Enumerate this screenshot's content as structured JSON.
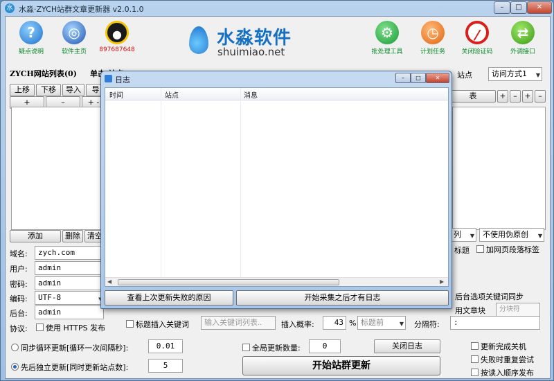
{
  "window": {
    "title": "水淼·ZYCH站群文章更新器 v2.0.1.0",
    "minimize": "–",
    "maximize": "□",
    "close": "✕"
  },
  "toolbar": {
    "help_label": "疑点说明",
    "homepage_label": "软件主页",
    "qq_label": "897687648",
    "batch_label": "批处理工具",
    "schedule_label": "计划任务",
    "captcha_label": "关闭验证码",
    "api_label": "外调接口",
    "brand_name": "水淼软件",
    "brand_url": "shuimiao.net"
  },
  "site_list": {
    "title": "ZYCH网站列表(0)",
    "hint": "单击:站点",
    "move_up": "上移",
    "move_down": "下移",
    "import": "导入",
    "export": "导",
    "plus": "+",
    "minus": "–",
    "plus2": "+ -",
    "add": "添加",
    "delete": "删除",
    "clear": "清空"
  },
  "right": {
    "site_label": "站点",
    "access_mode": "访问方式1",
    "small_buttons": [
      "+",
      "–",
      "+",
      "–"
    ],
    "table_fragment": "表",
    "combo_fragment": "列",
    "pseudo_original": "不使用伪原创",
    "title_fragment": "标题",
    "add_tags": "加网页段落标签",
    "keyword_sync": "后台选项关键词同步",
    "article_block": "用文章块",
    "separator_placeholder": "分块符"
  },
  "form": {
    "domain_label": "域名:",
    "domain_value": "zych.com",
    "user_label": "用户:",
    "user_value": "admin",
    "password_label": "密码:",
    "password_value": "admin",
    "encoding_label": "编码:",
    "encoding_value": "UTF-8",
    "backend_label": "后台:",
    "backend_value": "admin",
    "protocol_label": "协议:",
    "https_label": "使用 HTTPS 发布"
  },
  "options": {
    "title_keyword_label": "标题插入关键词",
    "keyword_placeholder": "输入关键词列表..",
    "insert_rate_label": "插入概率:",
    "insert_rate_value": "43",
    "percent": "%",
    "position_value": "标题前",
    "separator_label": "分隔符:",
    "separator_value": ":"
  },
  "bottom": {
    "sync_loop_label": "同步循环更新[循环一次间隔秒]:",
    "sync_loop_value": "0.01",
    "sequential_label": "先后独立更新[同时更新站点数]:",
    "sequential_value": "5",
    "global_count_label": "全局更新数量:",
    "global_count_value": "0",
    "close_log": "关闭日志",
    "start_update": "开始站群更新",
    "shutdown_label": "更新完成关机",
    "retry_label": "失败时重复尝试",
    "order_publish_label": "按读入顺序发布"
  },
  "log": {
    "title": "日志",
    "columns": [
      "时间",
      "站点",
      "消息"
    ],
    "last_fail_button": "查看上次更新失败的原因",
    "log_hint_button": "开始采集之后才有日志"
  },
  "colors": {
    "brand_blue": "#1670c4",
    "green_text": "#0b8a2a"
  }
}
